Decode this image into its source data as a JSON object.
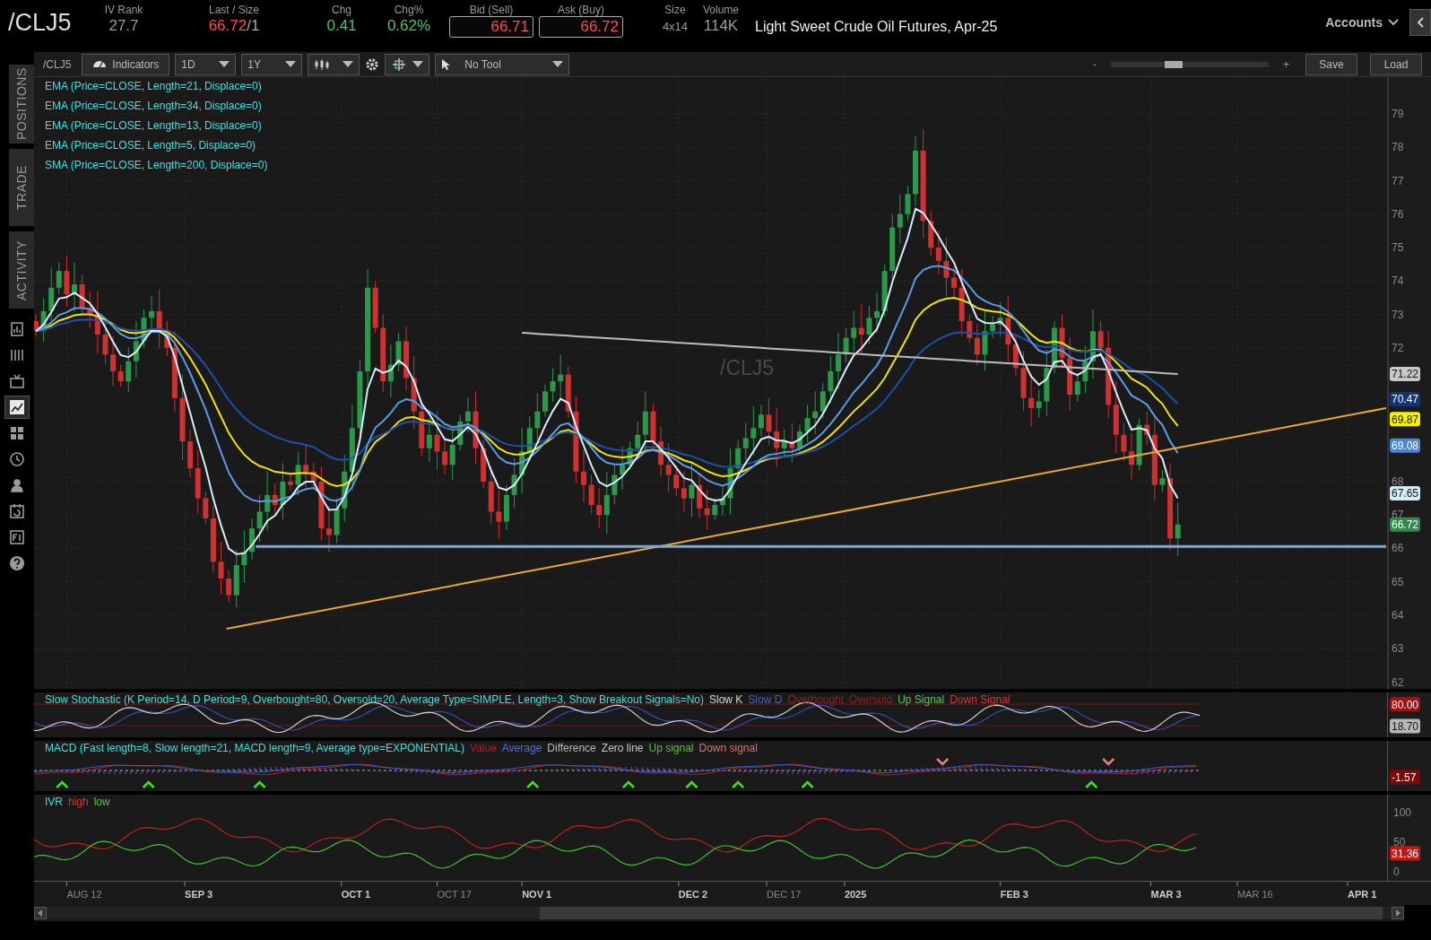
{
  "header": {
    "symbol": "/CLJ5",
    "quote_fields": [
      {
        "label": "IV Rank",
        "value": "27.7",
        "color": "#9a9a9a",
        "boxed": false
      },
      {
        "label": "Last / Size",
        "value": "66.72",
        "suffix": "/1",
        "color": "#ff4d4d",
        "boxed": false
      },
      {
        "label": "Chg",
        "value": "0.41",
        "color": "#4fc36b",
        "boxed": false
      },
      {
        "label": "Chg%",
        "value": "0.62%",
        "color": "#4fc36b",
        "boxed": false
      },
      {
        "label": "Bid (Sell)",
        "value": "66.71",
        "color": "#ff4d4d",
        "boxed": true
      },
      {
        "label": "Ask (Buy)",
        "value": "66.72",
        "color": "#ff4d4d",
        "boxed": true
      },
      {
        "label": "Size",
        "value": "4x14",
        "color": "#9a9a9a",
        "boxed": false
      },
      {
        "label": "Volume",
        "value": "114K",
        "color": "#9a9a9a",
        "boxed": false
      }
    ],
    "description": "Light Sweet Crude Oil Futures, Apr-25",
    "accounts": "Accounts"
  },
  "sidebar": {
    "tabs": [
      {
        "label": "POSITIONS",
        "selected": false
      },
      {
        "label": "TRADE",
        "selected": false
      },
      {
        "label": "ACTIVITY",
        "selected": false
      }
    ],
    "icons": [
      {
        "kind": "report",
        "selected": false
      },
      {
        "kind": "list",
        "selected": false
      },
      {
        "kind": "tv",
        "selected": false
      },
      {
        "kind": "chart",
        "selected": true
      },
      {
        "kind": "grid",
        "selected": false
      },
      {
        "kind": "clock",
        "selected": false
      },
      {
        "kind": "people",
        "selected": false
      },
      {
        "kind": "calendar",
        "selected": false
      },
      {
        "kind": "fi",
        "selected": false
      },
      {
        "kind": "help",
        "selected": false
      }
    ]
  },
  "toolbar": {
    "symbol": "/CLJ5",
    "indicators": "Indicators",
    "aggregation": "1D",
    "period": "1Y",
    "drawing_tool": "No Tool",
    "zoom_out": "-",
    "zoom_in": "+",
    "zoom": {
      "level": 0.4
    },
    "save": "Save",
    "load": "Load"
  },
  "chart": {
    "watermark": "/CLJ5",
    "studies": [
      {
        "label": "EMA (Price=CLOSE, Length=21, Displace=0)",
        "kind": "ema",
        "color": "#f2e600"
      },
      {
        "label": "EMA (Price=CLOSE, Length=34, Displace=0)",
        "kind": "ema",
        "color": "#1f4fa8"
      },
      {
        "label": "EMA (Price=CLOSE, Length=13, Displace=0)",
        "kind": "ema",
        "color": "#5b9be8"
      },
      {
        "label": "EMA (Price=CLOSE, Length=5, Displace=0)",
        "kind": "ema",
        "color": "#d8eefc"
      },
      {
        "label": "SMA (Price=CLOSE, Length=200, Displace=0)",
        "kind": "sma",
        "color": "#bdbdbd"
      }
    ],
    "price_labels": [
      {
        "text": "71.22",
        "color": "#c8c8c8"
      },
      {
        "text": "70.47",
        "color": "#12357a"
      },
      {
        "text": "69.87",
        "color": "#f2f200"
      },
      {
        "text": "69.08",
        "color": "#4a86d8"
      },
      {
        "text": "67.65",
        "color": "#d4ecfa"
      },
      {
        "text": "66.72",
        "color": "#2e8b4a"
      }
    ],
    "axis_labels": [
      "79",
      "78",
      "77",
      "76",
      "75",
      "74",
      "73",
      "72",
      "68",
      "67",
      "66",
      "65",
      "64",
      "63",
      "62"
    ],
    "date_labels": [
      {
        "label": "AUG 12",
        "emphasized": false
      },
      {
        "label": "SEP 3",
        "emphasized": true
      },
      {
        "label": "OCT 1",
        "emphasized": true
      },
      {
        "label": "OCT 17",
        "emphasized": false
      },
      {
        "label": "NOV 1",
        "emphasized": true
      },
      {
        "label": "DEC 2",
        "emphasized": true
      },
      {
        "label": "DEC 17",
        "emphasized": false
      },
      {
        "label": "2025",
        "emphasized": true
      },
      {
        "label": "FEB 3",
        "emphasized": true
      },
      {
        "label": "MAR 3",
        "emphasized": true
      },
      {
        "label": "MAR 16",
        "emphasized": false
      },
      {
        "label": "APR 1",
        "emphasized": true
      }
    ]
  },
  "lower_studies": [
    {
      "kind": "stochastic",
      "legend": [
        {
          "text": "Slow Stochastic (K Period=14, D Period=9, Overbought=80, Oversold=20, Average Type=SIMPLE, Length=3, Show Breakout Signals=No)",
          "color": "#3ee0e0"
        },
        {
          "text": "Slow K",
          "color": "#d8d8d8"
        },
        {
          "text": "Slow D",
          "color": "#3a62d8"
        },
        {
          "text": "Overbought",
          "color": "#8e2020"
        },
        {
          "text": "Oversold",
          "color": "#8e2020"
        },
        {
          "text": "Up Signal",
          "color": "#48d048"
        },
        {
          "text": "Down Signal",
          "color": "#e03030"
        }
      ],
      "axis_labels": [
        {
          "text": "80.00",
          "color": "#a01010"
        },
        {
          "text": "18.70",
          "color": "#b8b8b8"
        }
      ]
    },
    {
      "kind": "macd",
      "legend": [
        {
          "text": "MACD (Fast length=8, Slow length=21, MACD length=9, Average type=EXPONENTIAL)",
          "color": "#3ee0e0"
        },
        {
          "text": "Value",
          "color": "#b82020"
        },
        {
          "text": "Average",
          "color": "#4a74d8"
        },
        {
          "text": "Difference",
          "color": "#b8b8b8"
        },
        {
          "text": "Zero line",
          "color": "#c8c8c8"
        },
        {
          "text": "Up signal",
          "color": "#50c830"
        },
        {
          "text": "Down signal",
          "color": "#e07070"
        }
      ],
      "axis_labels": [
        {
          "text": "-1.57",
          "color": "#7a0a0a"
        }
      ]
    },
    {
      "kind": "ivr",
      "legend": [
        {
          "text": "IVR",
          "color": "#3ee0e0"
        },
        {
          "text": "high",
          "color": "#e03030"
        },
        {
          "text": "low",
          "color": "#48d048"
        }
      ],
      "ticks": [
        "100",
        "50",
        "0"
      ],
      "axis_labels": [
        {
          "text": "31.36",
          "color": "#c01818"
        }
      ]
    }
  ]
}
